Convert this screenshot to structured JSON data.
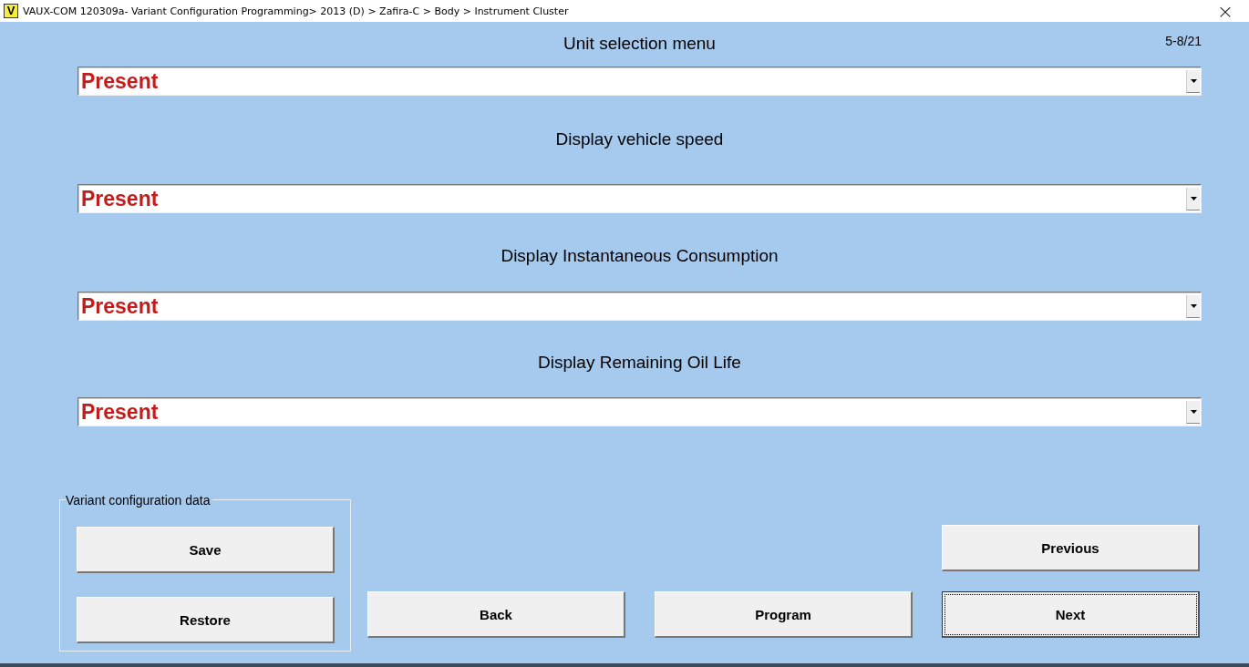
{
  "window": {
    "title": "VAUX-COM 120309a- Variant Configuration Programming> 2013 (D) > Zafira-C > Body > Instrument Cluster",
    "app_icon_letter": "V",
    "close": "×"
  },
  "page_counter": "5-8/21",
  "fields": [
    {
      "label": "Unit selection menu",
      "value": "Present"
    },
    {
      "label": "Display vehicle speed",
      "value": "Present"
    },
    {
      "label": "Display Instantaneous Consumption",
      "value": "Present"
    },
    {
      "label": "Display Remaining Oil Life",
      "value": "Present"
    }
  ],
  "variant_group": {
    "title": "Variant configuration data",
    "buttons": [
      {
        "label": "Save",
        "focused": false
      },
      {
        "label": "Restore",
        "focused": false
      }
    ]
  },
  "nav_buttons": [
    {
      "label": "Back",
      "focused": false
    },
    {
      "label": "Program",
      "focused": false
    },
    {
      "label": "Previous",
      "focused": false
    },
    {
      "label": "Next",
      "focused": true
    }
  ]
}
